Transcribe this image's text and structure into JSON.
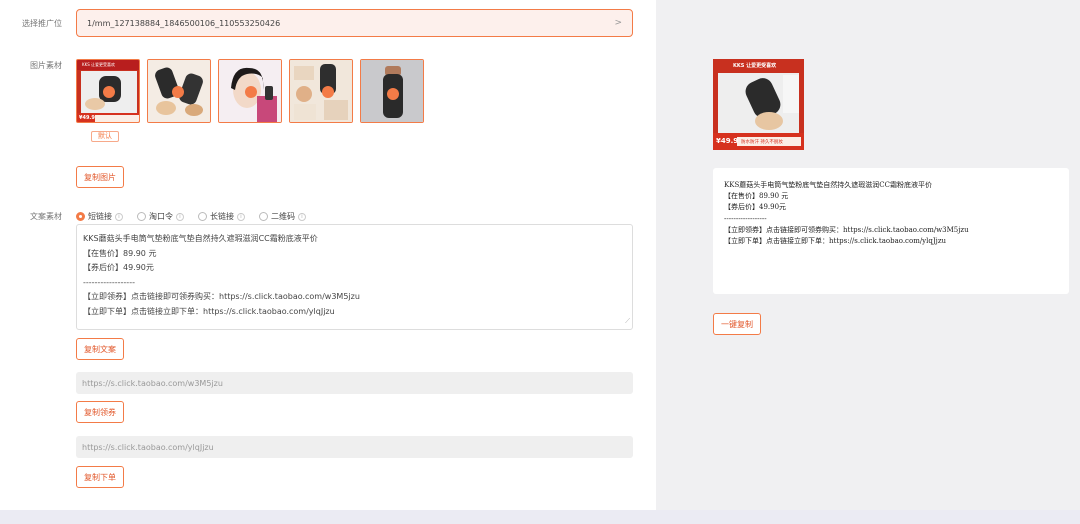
{
  "form": {
    "slot_label": "选择推广位",
    "slot_value": "1/mm_127138884_1846500106_110553250426",
    "slot_chevron": ">",
    "image_label": "图片素材",
    "default_badge": "默认",
    "copy_image_button": "复制图片",
    "copy_label": "文案素材",
    "radio_options": [
      "短链接",
      "淘口令",
      "长链接",
      "二维码"
    ],
    "radio_selected": "短链接",
    "text_lines": [
      "KKS蘑菇头手电筒气垫粉底气垫自然持久遮瑕滋润CC霜粉底液平价",
      "【在售价】89.90 元",
      "【券后价】49.90元",
      "------------------",
      "【立即领券】点击链接即可领券购买：https://s.click.taobao.com/w3M5jzu",
      "【立即下单】点击链接立即下单：https://s.click.taobao.com/ylqJjzu"
    ],
    "copy_text_button": "复制文案",
    "coupon_url": "https://s.click.taobao.com/w3M5jzu",
    "copy_coupon_button": "复制领券",
    "order_url": "https://s.click.taobao.com/ylqJjzu",
    "copy_order_button": "复制下单"
  },
  "preview": {
    "text_lines": [
      "KKS蘑菇头手电筒气垫粉底气垫自然持久遮瑕滋润CC霜粉底液平价",
      "【在售价】89.90 元",
      "【券后价】49.90元",
      "------------------",
      "【立即领券】点击链接即可领券购买：https://s.click.taobao.com/w3M5jzu",
      "【立即下单】点击链接立即下单：https://s.click.taobao.com/ylqJjzu"
    ],
    "copy_all_button": "一键复制",
    "image_banner": "KKS 让爱更受喜欢",
    "image_price": "¥49.9",
    "image_tag": "防水防汗 持久不脱妆"
  },
  "thumbnails": [
    {
      "name": "product-image-1",
      "banner": "KKS 让爱更受喜欢",
      "price": "¥49.9"
    },
    {
      "name": "product-image-2"
    },
    {
      "name": "product-image-3"
    },
    {
      "name": "product-image-4"
    },
    {
      "name": "product-image-5"
    }
  ],
  "colors": {
    "accent": "#f37b47",
    "accent_text": "#e2572a",
    "slot_bg": "#fdf0ec",
    "field_bg": "#efefef",
    "right_bg": "#f0f0f2"
  },
  "icons": {
    "chevron": "chevron-right-icon",
    "check": "check-icon",
    "info": "info-icon",
    "resize": "resize-handle-icon"
  }
}
